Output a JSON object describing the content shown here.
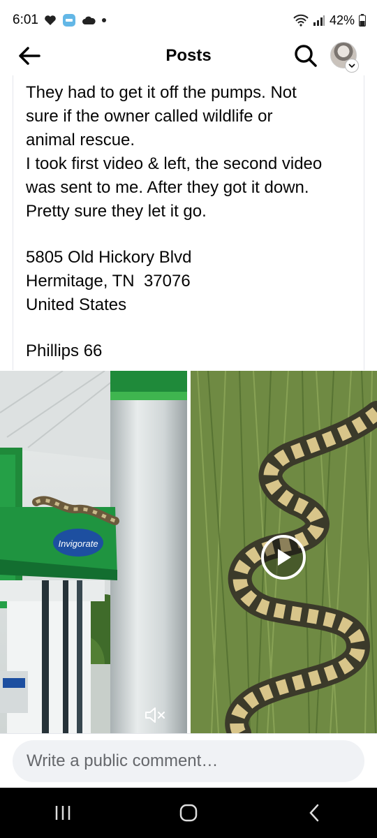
{
  "status_bar": {
    "time": "6:01",
    "battery": "42%",
    "icons": [
      "heart-icon",
      "app-notification-icon",
      "cloud-icon",
      "dot-icon",
      "wifi-icon",
      "signal-icon",
      "battery-icon"
    ]
  },
  "header": {
    "title": "Posts",
    "back_icon": "back-arrow-icon",
    "search_icon": "search-icon"
  },
  "post": {
    "lines": [
      "They had to get it off the pumps. Not",
      "sure if the owner called wildlife or",
      "animal rescue.",
      "I took first video & left, the second video",
      "was sent to me. After they got it down.",
      "Pretty sure they let it go."
    ],
    "address_lines": [
      "5805 Old Hickory Blvd",
      "Hermitage, TN  37076",
      "United States"
    ],
    "place": "Phillips 66"
  },
  "media": {
    "left": {
      "sign_text": "Invigorate",
      "mute_icon": "mute-icon"
    },
    "right": {
      "play_icon": "play-icon"
    }
  },
  "comment": {
    "placeholder": "Write a public comment…"
  },
  "colors": {
    "canopy_green": "#1f8a3a",
    "sign_blue": "#1d4fa0",
    "grass": "#6f8a43"
  }
}
